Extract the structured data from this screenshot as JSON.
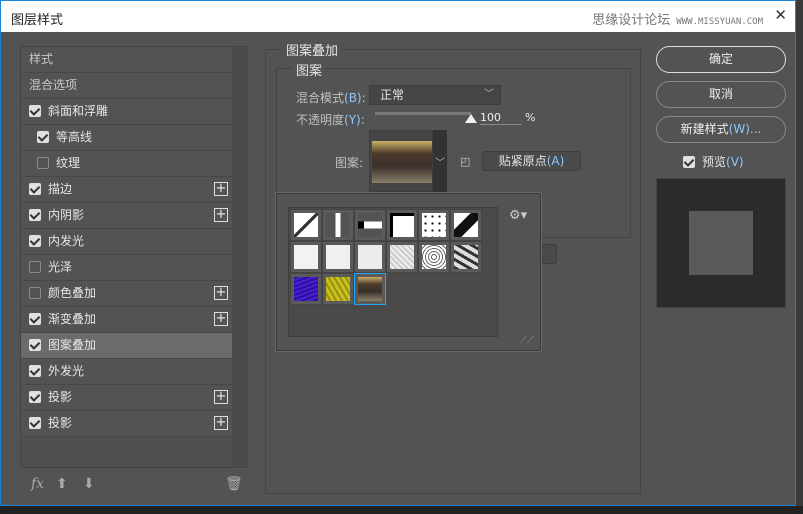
{
  "window": {
    "title": "图层样式",
    "watermark": "思缘设计论坛",
    "watermark_url_text": "WWW.MISSYUAN.COM",
    "close_icon": "close-icon"
  },
  "sidebar": {
    "items": [
      {
        "label": "样式",
        "type": "header"
      },
      {
        "label": "混合选项",
        "type": "header"
      },
      {
        "label": "斜面和浮雕",
        "checked": true
      },
      {
        "label": "等高线",
        "checked": true,
        "indent": true
      },
      {
        "label": "纹理",
        "checked": false,
        "indent": true
      },
      {
        "label": "描边",
        "checked": true,
        "plus": true
      },
      {
        "label": "内阴影",
        "checked": true,
        "plus": true
      },
      {
        "label": "内发光",
        "checked": true
      },
      {
        "label": "光泽",
        "checked": false
      },
      {
        "label": "颜色叠加",
        "checked": false,
        "plus": true
      },
      {
        "label": "渐变叠加",
        "checked": true,
        "plus": true
      },
      {
        "label": "图案叠加",
        "checked": true,
        "selected": true
      },
      {
        "label": "外发光",
        "checked": true
      },
      {
        "label": "投影",
        "checked": true,
        "plus": true
      },
      {
        "label": "投影",
        "checked": true,
        "plus": true
      }
    ],
    "footer": {
      "fx": "fx",
      "up_icon": "arrow-up-icon",
      "down_icon": "arrow-down-icon",
      "trash_icon": "trash-icon"
    }
  },
  "main": {
    "group_title": "图案叠加",
    "subgroup_title": "图案",
    "blend_mode_label": "混合模式",
    "blend_mode_key": "(B)",
    "blend_mode_value": "正常",
    "opacity_label": "不透明度",
    "opacity_key": "(Y)",
    "opacity_value": "100",
    "opacity_unit": "%",
    "opacity_percent": 100,
    "pattern_label": "图案:",
    "snap_button": "贴紧原点",
    "snap_key": "(A)",
    "new_preset_icon": "new-preset-icon"
  },
  "pattern_picker": {
    "gear_icon": "gear-icon",
    "patterns": [
      "diagonal-line",
      "vertical-bar",
      "horizontal-bar",
      "corner-frame",
      "dots",
      "diagonal-thick",
      "white-noise-1",
      "white-noise-2",
      "white-noise-3",
      "gray-noise",
      "concentric-squares",
      "camouflage",
      "blue-texture",
      "yellow-texture",
      "street-photo"
    ],
    "selected": "street-photo",
    "selected_color": "#22a7f0"
  },
  "right": {
    "ok": "确定",
    "cancel": "取消",
    "new_style": "新建样式",
    "new_style_key": "(W)...",
    "preview_label": "预览",
    "preview_key": "(V)",
    "preview_checked": true
  }
}
